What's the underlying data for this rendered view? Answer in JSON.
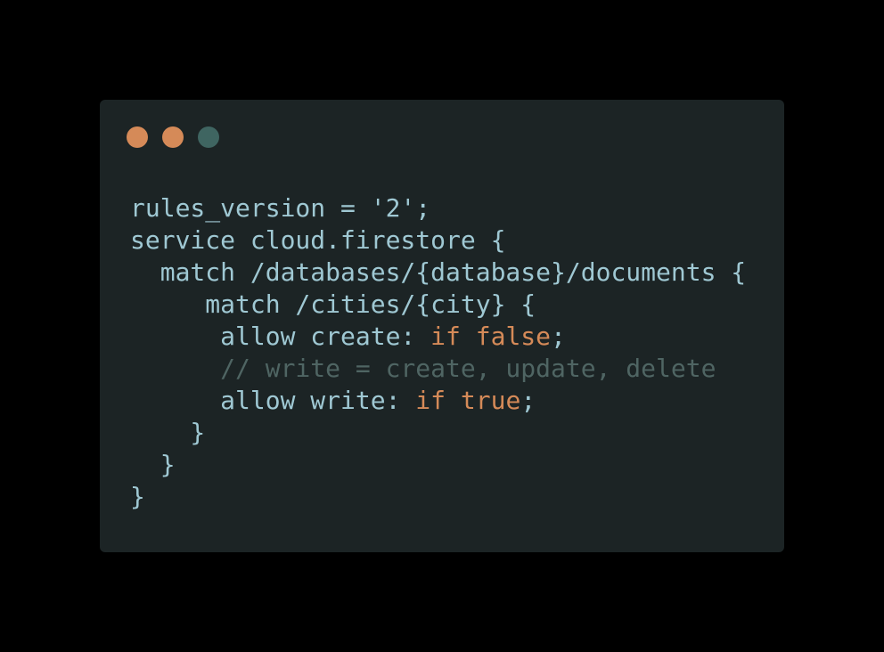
{
  "colors": {
    "window_bg": "#1c2425",
    "page_bg": "#000000",
    "text": "#9fc8d3",
    "keyword": "#d58a58",
    "comment": "#4f6563",
    "dot_1": "#d58a58",
    "dot_2": "#d58a58",
    "dot_3": "#3f6561"
  },
  "window_controls": [
    {
      "icon": "circle-icon"
    },
    {
      "icon": "circle-icon"
    },
    {
      "icon": "circle-icon"
    }
  ],
  "code": {
    "lines": [
      [
        {
          "t": "rules_version = '2';",
          "k": "text"
        }
      ],
      [
        {
          "t": "service cloud.firestore {",
          "k": "text"
        }
      ],
      [
        {
          "t": "  match /databases/{database}/documents {",
          "k": "text"
        }
      ],
      [
        {
          "t": "     match /cities/{city} {",
          "k": "text"
        }
      ],
      [
        {
          "t": "      allow create: ",
          "k": "text"
        },
        {
          "t": "if false",
          "k": "keyword"
        },
        {
          "t": ";",
          "k": "text"
        }
      ],
      [
        {
          "t": "      // write = create, update, delete",
          "k": "comment"
        }
      ],
      [
        {
          "t": "      allow write: ",
          "k": "text"
        },
        {
          "t": "if true",
          "k": "keyword"
        },
        {
          "t": ";",
          "k": "text"
        }
      ],
      [
        {
          "t": "    }",
          "k": "text"
        }
      ],
      [
        {
          "t": "  }",
          "k": "text"
        }
      ],
      [
        {
          "t": "}",
          "k": "text"
        }
      ]
    ]
  }
}
